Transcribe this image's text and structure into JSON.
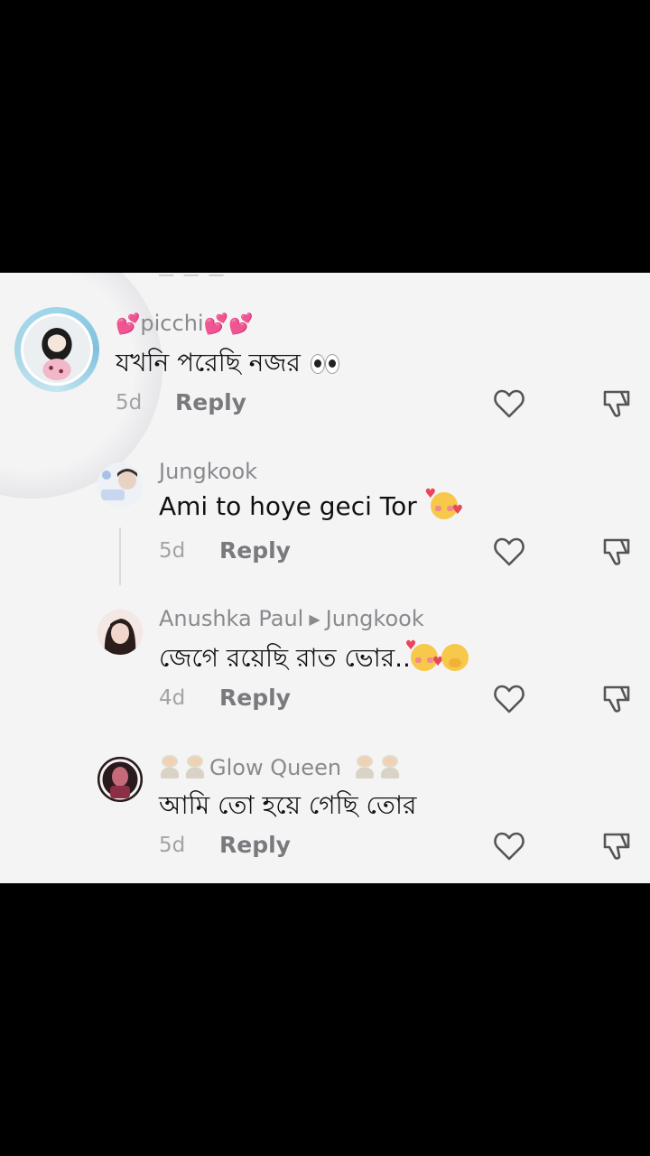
{
  "comments": [
    {
      "username": "picchi",
      "text": "যখনি পরেছি নজর",
      "time": "5d",
      "reply_label": "Reply"
    },
    {
      "username": "Jungkook",
      "text": "Ami to hoye geci Tor",
      "time": "5d",
      "reply_label": "Reply"
    },
    {
      "username": "Anushka Paul",
      "reply_to": "Jungkook",
      "text": "জেগে রয়েছি রাত ভোর..",
      "time": "4d",
      "reply_label": "Reply"
    },
    {
      "username": "Glow Queen",
      "text": "আমি তো হয়ে গেছি তোর",
      "time": "5d",
      "reply_label": "Reply"
    }
  ],
  "icons": {
    "like": "heart-outline-icon",
    "dislike": "thumbs-down-outline-icon"
  },
  "colors": {
    "background": "#000000",
    "panel": "#f4f4f5",
    "username": "#8a8a8e",
    "text": "#111111",
    "icon": "#555555",
    "avatar_ring": "#7fc2dd"
  }
}
